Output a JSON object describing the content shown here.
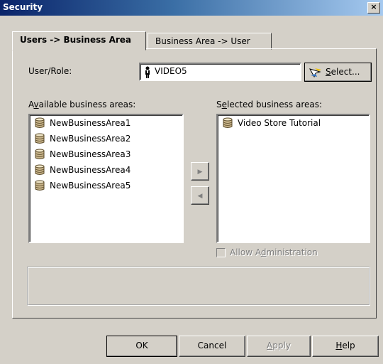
{
  "window": {
    "title": "Security",
    "close_glyph": "×"
  },
  "tabs": [
    {
      "label": "Users -> Business Area",
      "active": true
    },
    {
      "label": "Business Area -> User",
      "active": false
    }
  ],
  "user_role": {
    "label_pre": "User/Role:",
    "value": "VIDEO5",
    "select_button": {
      "pre": "",
      "mnemonic": "S",
      "post": "elect..."
    }
  },
  "available": {
    "label_pre": "A",
    "label_mnemonic": "v",
    "label_post": "ailable business areas:",
    "items": [
      "NewBusinessArea1",
      "NewBusinessArea2",
      "NewBusinessArea3",
      "NewBusinessArea4",
      "NewBusinessArea5"
    ]
  },
  "selected": {
    "label_pre": "S",
    "label_mnemonic": "e",
    "label_post": "lected business areas:",
    "items": [
      "Video Store Tutorial"
    ]
  },
  "move_buttons": {
    "add": "▶",
    "remove": "◀"
  },
  "allow_admin": {
    "pre": "Allow A",
    "mnemonic": "d",
    "post": "ministration",
    "checked": false,
    "enabled": false
  },
  "buttons": {
    "ok": "OK",
    "cancel": "Cancel",
    "apply": {
      "mnemonic": "A",
      "post": "pply",
      "enabled": false
    },
    "help": {
      "mnemonic": "H",
      "post": "elp"
    }
  },
  "icons": {
    "user": "user-icon",
    "business_area": "database-icon",
    "select": "select-arrow-icon"
  }
}
